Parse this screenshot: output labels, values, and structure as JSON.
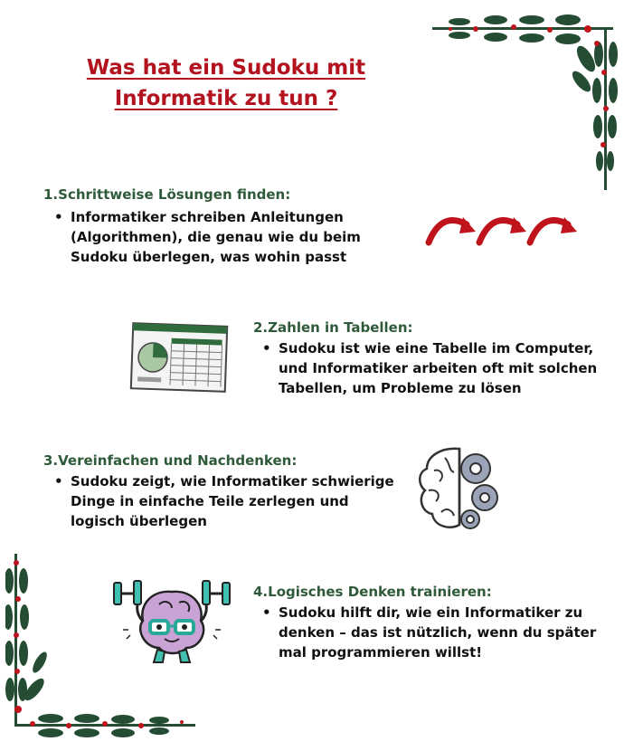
{
  "title": {
    "line1": "Was hat ein Sudoku mit",
    "line2": "Informatik zu tun ?"
  },
  "sections": [
    {
      "heading": "1.Schrittweise Lösungen finden:",
      "bullet": "Informatiker schreiben Anleitungen (Algorithmen), die genau wie du beim Sudoku überlegen, was wohin passt"
    },
    {
      "heading": "2.Zahlen in Tabellen:",
      "bullet": "Sudoku ist wie eine Tabelle im Computer, und Informatiker arbeiten oft mit solchen Tabellen, um Probleme zu lösen"
    },
    {
      "heading": "3.Vereinfachen und Nachdenken:",
      "bullet": "Sudoku zeigt, wie Informatiker schwierige Dinge in einfache Teile zerlegen und logisch überlegen"
    },
    {
      "heading": "4.Logisches Denken trainieren:",
      "bullet": "Sudoku hilft dir, wie ein Informatiker zu denken – das ist nützlich, wenn du später mal programmieren willst!"
    }
  ],
  "colors": {
    "title": "#b3121f",
    "heading": "#2f5a3a",
    "arrow": "#c0141c",
    "holly": "#254d33",
    "berry": "#c0141c"
  },
  "icons": [
    "holly-corner-top-right",
    "holly-corner-bottom-left",
    "curved-arrows-icon",
    "spreadsheet-icon",
    "brain-gear-icon",
    "brain-dumbbell-icon"
  ]
}
